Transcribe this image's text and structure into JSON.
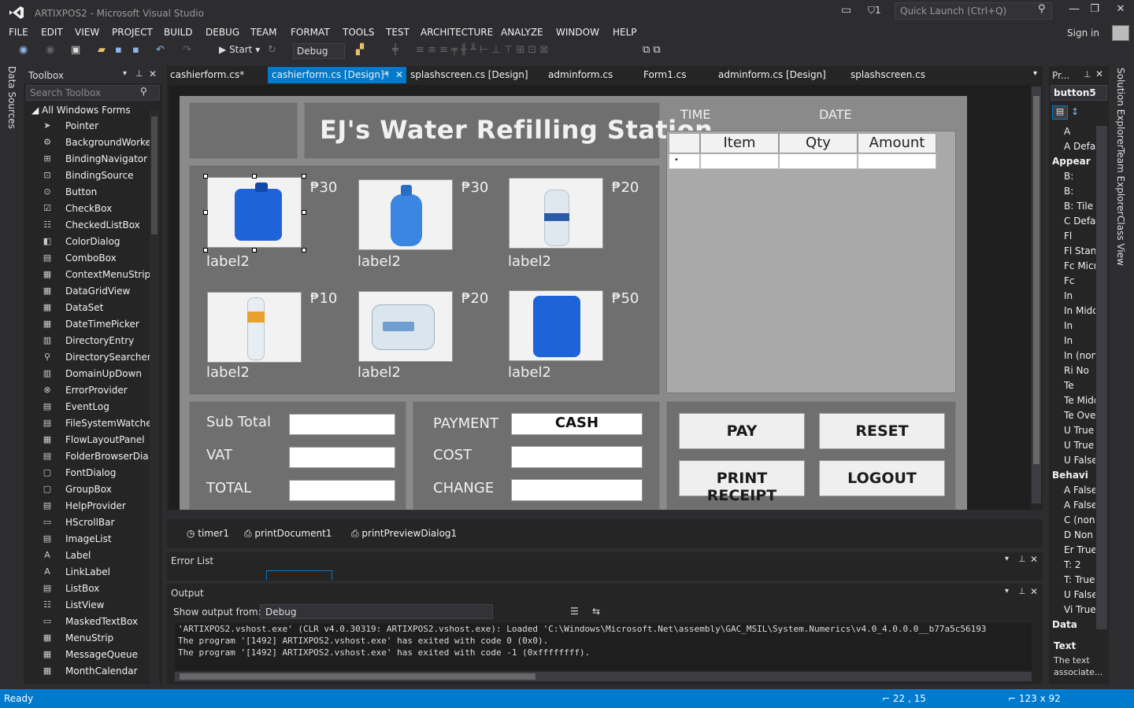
{
  "window": {
    "title": "ARTIXPOS2 - Microsoft Visual Studio",
    "filter_count": "1",
    "quick_launch_placeholder": "Quick Launch (Ctrl+Q)",
    "sign_in": "Sign in",
    "minimize": "▾",
    "restore": "❐",
    "close": "✕"
  },
  "menu": [
    "FILE",
    "EDIT",
    "VIEW",
    "PROJECT",
    "BUILD",
    "DEBUG",
    "TEAM",
    "FORMAT",
    "TOOLS",
    "TEST",
    "ARCHITECTURE",
    "ANALYZE",
    "WINDOW",
    "HELP"
  ],
  "toolbar": {
    "start_label": "Start",
    "config": "Debug"
  },
  "left_strip": {
    "data_sources": "Data Sources"
  },
  "toolbox": {
    "title": "Toolbox",
    "search_placeholder": "Search Toolbox",
    "group": "All Windows Forms",
    "items": [
      "Pointer",
      "BackgroundWorker",
      "BindingNavigator",
      "BindingSource",
      "Button",
      "CheckBox",
      "CheckedListBox",
      "ColorDialog",
      "ComboBox",
      "ContextMenuStrip",
      "DataGridView",
      "DataSet",
      "DateTimePicker",
      "DirectoryEntry",
      "DirectorySearcher",
      "DomainUpDown",
      "ErrorProvider",
      "EventLog",
      "FileSystemWatcher",
      "FlowLayoutPanel",
      "FolderBrowserDia...",
      "FontDialog",
      "GroupBox",
      "HelpProvider",
      "HScrollBar",
      "ImageList",
      "Label",
      "LinkLabel",
      "ListBox",
      "ListView",
      "MaskedTextBox",
      "MenuStrip",
      "MessageQueue",
      "MonthCalendar"
    ]
  },
  "doc_tabs": [
    "cashierform.cs*",
    "cashierform.cs [Design]*",
    "splashscreen.cs [Design]",
    "adminform.cs",
    "Form1.cs",
    "adminform.cs [Design]",
    "splashscreen.cs"
  ],
  "form": {
    "title": "EJ's Water Refilling Station",
    "products": [
      {
        "price": "₱30",
        "label": "label2",
        "kind": "jerrycan"
      },
      {
        "price": "₱30",
        "label": "label2",
        "kind": "gallon"
      },
      {
        "price": "₱20",
        "label": "label2",
        "kind": "bottle-large"
      },
      {
        "price": "₱10",
        "label": "label2",
        "kind": "bottle-small"
      },
      {
        "price": "₱20",
        "label": "label2",
        "kind": "container-clear"
      },
      {
        "price": "₱50",
        "label": "label2",
        "kind": "container-blue"
      }
    ],
    "time_label": "TIME",
    "date_label": "DATE",
    "grid": {
      "columns": [
        "Item",
        "Qty",
        "Amount"
      ],
      "row_marker": "•"
    },
    "sub_total": "Sub Total",
    "vat": "VAT",
    "total": "TOTAL",
    "payment": "PAYMENT",
    "payment_value": "CASH",
    "cost": "COST",
    "change": "CHANGE",
    "buttons": {
      "pay": "PAY",
      "reset": "RESET",
      "print": "PRINT RECEIPT",
      "logout": "LOGOUT"
    }
  },
  "components": [
    "timer1",
    "printDocument1",
    "printPreviewDialog1"
  ],
  "error_list": {
    "title": "Error List"
  },
  "output": {
    "title": "Output",
    "show_from": "Show output from:",
    "source": "Debug",
    "lines": [
      "'ARTIXPOS2.vshost.exe' (CLR v4.0.30319: ARTIXPOS2.vshost.exe): Loaded 'C:\\Windows\\Microsoft.Net\\assembly\\GAC_MSIL\\System.Numerics\\v4.0_4.0.0.0__b77a5c56193",
      "The program '[1492] ARTIXPOS2.vshost.exe' has exited with code 0 (0x0).",
      "The program '[1492] ARTIXPOS2.vshost.exe' has exited with code -1 (0xffffffff)."
    ]
  },
  "properties": {
    "title": "Pr...",
    "object": "button5",
    "rows": [
      {
        "t": "row",
        "text": "A"
      },
      {
        "t": "row",
        "text": "A Defa"
      },
      {
        "t": "cat",
        "text": "Appear"
      },
      {
        "t": "row",
        "text": "B:"
      },
      {
        "t": "row",
        "text": "B:"
      },
      {
        "t": "row",
        "text": "B: Tile"
      },
      {
        "t": "row",
        "text": "C Defa"
      },
      {
        "t": "row",
        "text": "Fl"
      },
      {
        "t": "row",
        "text": "Fl Stan"
      },
      {
        "t": "row",
        "text": "Fc Micr"
      },
      {
        "t": "row",
        "text": "Fc"
      },
      {
        "t": "row",
        "text": "In"
      },
      {
        "t": "row",
        "text": "In Midd"
      },
      {
        "t": "row",
        "text": "In"
      },
      {
        "t": "row",
        "text": "In"
      },
      {
        "t": "row",
        "text": "In (non"
      },
      {
        "t": "row",
        "text": "Ri No"
      },
      {
        "t": "row",
        "text": "Te"
      },
      {
        "t": "row",
        "text": "Te Midd"
      },
      {
        "t": "row",
        "text": "Te Over"
      },
      {
        "t": "row",
        "text": "U True"
      },
      {
        "t": "row",
        "text": "U True"
      },
      {
        "t": "row",
        "text": "U False"
      },
      {
        "t": "cat",
        "text": "Behavi"
      },
      {
        "t": "row",
        "text": "A False"
      },
      {
        "t": "row",
        "text": "A False"
      },
      {
        "t": "row",
        "text": "C (non"
      },
      {
        "t": "row",
        "text": "D Non"
      },
      {
        "t": "row",
        "text": "Er True"
      },
      {
        "t": "row",
        "text": "T: 2"
      },
      {
        "t": "row",
        "text": "T: True"
      },
      {
        "t": "row",
        "text": "U False"
      },
      {
        "t": "row",
        "text": "Vi True"
      },
      {
        "t": "cat",
        "text": "Data"
      }
    ],
    "desc_title": "Text",
    "desc_text_1": "The text",
    "desc_text_2": "associate..."
  },
  "right_strip": {
    "solution": "Solution Explorer",
    "team": "Team Explorer",
    "class": "Class View"
  },
  "status": {
    "text": "Ready",
    "position": "22 , 15",
    "size": "123 x 92"
  }
}
